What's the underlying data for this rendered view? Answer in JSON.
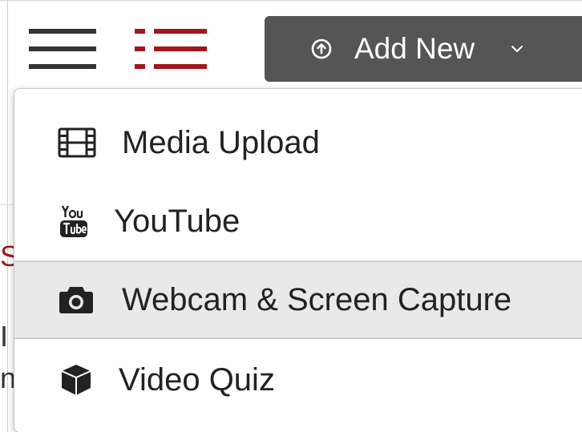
{
  "header": {
    "menu_icon": "hamburger-icon",
    "list_icon": "list-view-icon",
    "add_new_button": {
      "label": "Add New",
      "icon": "upload-circle-icon",
      "caret_icon": "chevron-down-icon"
    }
  },
  "background_text": {
    "fragment_red": "S",
    "fragment_dark_1": "I",
    "fragment_dark_2": "n"
  },
  "dropdown": {
    "items": [
      {
        "label": "Media Upload",
        "icon": "film-icon"
      },
      {
        "label": "YouTube",
        "icon": "youtube-icon"
      },
      {
        "label": "Webcam & Screen Capture",
        "icon": "camera-icon",
        "highlighted": true
      },
      {
        "label": "Video Quiz",
        "icon": "cube-icon"
      }
    ]
  },
  "colors": {
    "accent_red": "#a3161b",
    "button_bg": "#555555",
    "hover_bg": "#e9e9e9",
    "text": "#222222"
  }
}
